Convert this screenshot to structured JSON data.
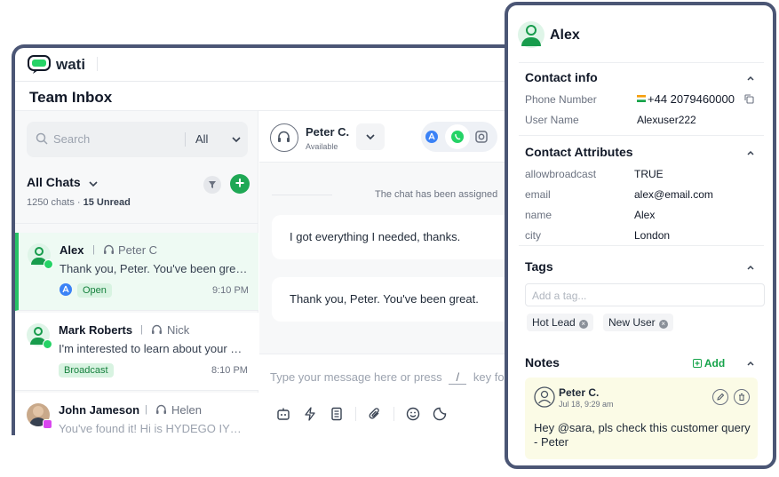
{
  "app": {
    "logo_text": "wati",
    "inbox_title": "Team Inbox"
  },
  "search": {
    "placeholder": "Search",
    "filter": "All"
  },
  "list": {
    "title": "All Chats",
    "count": "1250 chats",
    "unread": "15 Unread",
    "items": [
      {
        "name": "Alex",
        "agent": "Peter C",
        "message": "Thank you, Peter. You've been great.",
        "badge": "Open",
        "time": "9:10 PM"
      },
      {
        "name": "Mark Roberts",
        "agent": "Nick",
        "message": "I'm interested to learn about your products",
        "badge": "Broadcast",
        "time": "8:10 PM"
      },
      {
        "name": "John Jameson",
        "agent": "Helen",
        "message": "You've found it! Hi is HYDEGO IYOHO",
        "badge": "",
        "time": ""
      }
    ]
  },
  "conversation": {
    "agent_name": "Peter C.",
    "agent_status": "Available",
    "system_message": "The chat has been assigned",
    "messages": [
      "I got everything I needed, thanks.",
      "Thank you, Peter. You've been great."
    ],
    "composer_placeholder_a": "Type your message here or press",
    "composer_key": "/",
    "composer_placeholder_b": "key fo"
  },
  "contact": {
    "name": "Alex",
    "info_title": "Contact info",
    "phone_label": "Phone Number",
    "phone_value": "+44 2079460000",
    "user_label": "User Name",
    "user_value": "Alexuser222",
    "attr_title": "Contact Attributes",
    "attributes": [
      {
        "key": "allowbroadcast",
        "value": "TRUE"
      },
      {
        "key": "email",
        "value": "alex@email.com"
      },
      {
        "key": "name",
        "value": "Alex"
      },
      {
        "key": "city",
        "value": "London"
      }
    ],
    "tags_title": "Tags",
    "tag_placeholder": "Add a tag...",
    "tags": [
      "Hot Lead",
      "New User"
    ],
    "notes_title": "Notes",
    "notes_add": "Add",
    "note": {
      "author": "Peter C.",
      "date": "Jul 18, 9:29 am",
      "text": "Hey @sara, pls check this customer query - Peter"
    }
  },
  "colors": {
    "brand_green": "#1fa855",
    "whatsapp": "#25d366",
    "frame": "#4b5675"
  }
}
